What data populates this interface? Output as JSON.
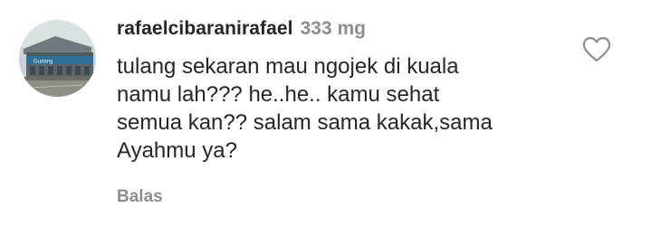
{
  "comment": {
    "username": "rafaelcibaranirafael",
    "time": "333 mg",
    "text": "tulang sekaran mau ngojek di kuala\nnamu lah??? he..he.. kamu sehat\nsemua kan?? salam sama kakak,sama\nAyahmu ya?",
    "reply_label": "Balas",
    "avatar": {
      "icon": "profile-photo",
      "sign_text": "Gudang"
    },
    "like_icon": "heart-outline-icon"
  },
  "colors": {
    "text": "#262626",
    "secondary": "#8e8e8e",
    "background": "#ffffff"
  }
}
